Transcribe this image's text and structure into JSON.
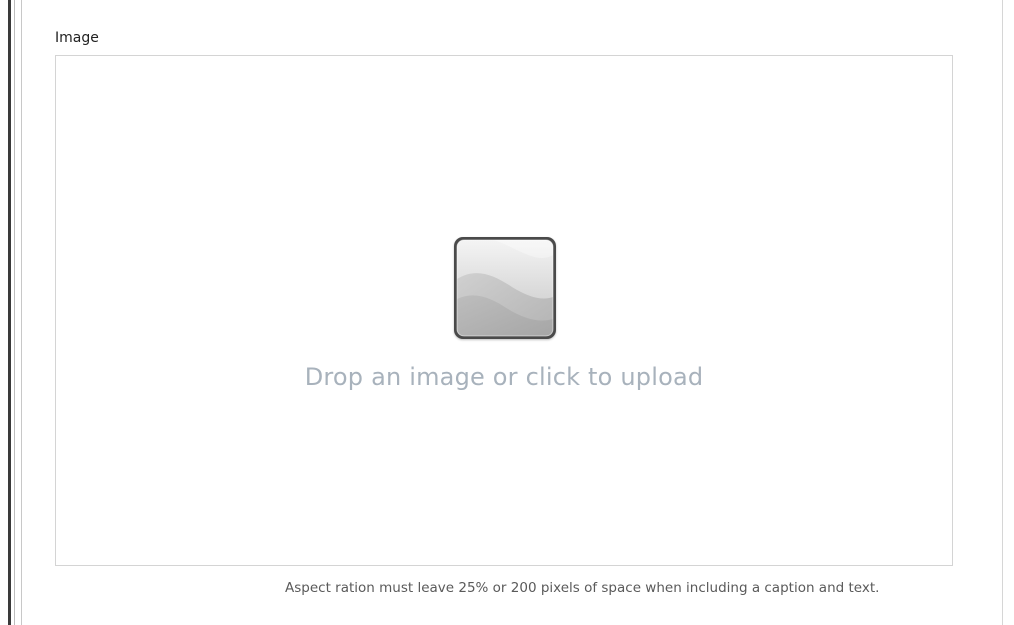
{
  "field": {
    "label": "Image"
  },
  "dropzone": {
    "prompt": "Drop an image or click to upload",
    "icon": "image-placeholder-icon"
  },
  "help": {
    "text": "Aspect ration must leave 25% or 200 pixels of space when including a caption and text."
  },
  "colors": {
    "prompt_text": "#a8b2bc",
    "border": "#d4d4d4",
    "help_text": "#5a5a5a"
  }
}
